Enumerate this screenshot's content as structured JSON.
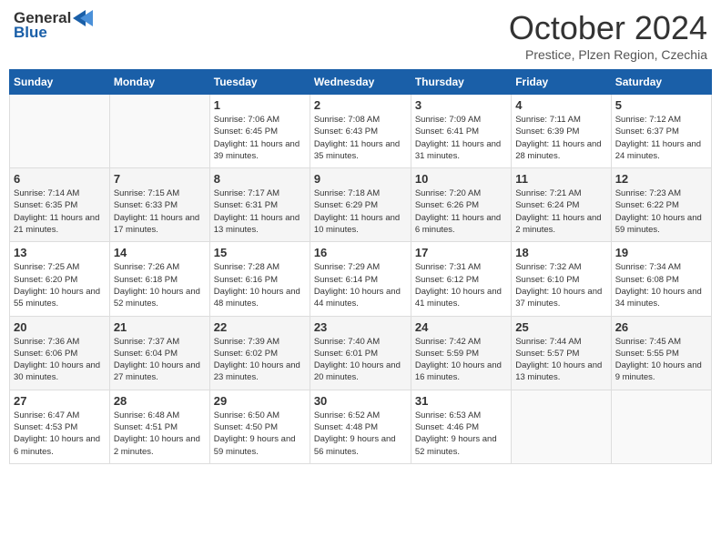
{
  "header": {
    "logo_line1": "General",
    "logo_line2": "Blue",
    "month": "October 2024",
    "location": "Prestice, Plzen Region, Czechia"
  },
  "days_of_week": [
    "Sunday",
    "Monday",
    "Tuesday",
    "Wednesday",
    "Thursday",
    "Friday",
    "Saturday"
  ],
  "weeks": [
    [
      {
        "day": "",
        "content": ""
      },
      {
        "day": "",
        "content": ""
      },
      {
        "day": "1",
        "content": "Sunrise: 7:06 AM\nSunset: 6:45 PM\nDaylight: 11 hours and 39 minutes."
      },
      {
        "day": "2",
        "content": "Sunrise: 7:08 AM\nSunset: 6:43 PM\nDaylight: 11 hours and 35 minutes."
      },
      {
        "day": "3",
        "content": "Sunrise: 7:09 AM\nSunset: 6:41 PM\nDaylight: 11 hours and 31 minutes."
      },
      {
        "day": "4",
        "content": "Sunrise: 7:11 AM\nSunset: 6:39 PM\nDaylight: 11 hours and 28 minutes."
      },
      {
        "day": "5",
        "content": "Sunrise: 7:12 AM\nSunset: 6:37 PM\nDaylight: 11 hours and 24 minutes."
      }
    ],
    [
      {
        "day": "6",
        "content": "Sunrise: 7:14 AM\nSunset: 6:35 PM\nDaylight: 11 hours and 21 minutes."
      },
      {
        "day": "7",
        "content": "Sunrise: 7:15 AM\nSunset: 6:33 PM\nDaylight: 11 hours and 17 minutes."
      },
      {
        "day": "8",
        "content": "Sunrise: 7:17 AM\nSunset: 6:31 PM\nDaylight: 11 hours and 13 minutes."
      },
      {
        "day": "9",
        "content": "Sunrise: 7:18 AM\nSunset: 6:29 PM\nDaylight: 11 hours and 10 minutes."
      },
      {
        "day": "10",
        "content": "Sunrise: 7:20 AM\nSunset: 6:26 PM\nDaylight: 11 hours and 6 minutes."
      },
      {
        "day": "11",
        "content": "Sunrise: 7:21 AM\nSunset: 6:24 PM\nDaylight: 11 hours and 2 minutes."
      },
      {
        "day": "12",
        "content": "Sunrise: 7:23 AM\nSunset: 6:22 PM\nDaylight: 10 hours and 59 minutes."
      }
    ],
    [
      {
        "day": "13",
        "content": "Sunrise: 7:25 AM\nSunset: 6:20 PM\nDaylight: 10 hours and 55 minutes."
      },
      {
        "day": "14",
        "content": "Sunrise: 7:26 AM\nSunset: 6:18 PM\nDaylight: 10 hours and 52 minutes."
      },
      {
        "day": "15",
        "content": "Sunrise: 7:28 AM\nSunset: 6:16 PM\nDaylight: 10 hours and 48 minutes."
      },
      {
        "day": "16",
        "content": "Sunrise: 7:29 AM\nSunset: 6:14 PM\nDaylight: 10 hours and 44 minutes."
      },
      {
        "day": "17",
        "content": "Sunrise: 7:31 AM\nSunset: 6:12 PM\nDaylight: 10 hours and 41 minutes."
      },
      {
        "day": "18",
        "content": "Sunrise: 7:32 AM\nSunset: 6:10 PM\nDaylight: 10 hours and 37 minutes."
      },
      {
        "day": "19",
        "content": "Sunrise: 7:34 AM\nSunset: 6:08 PM\nDaylight: 10 hours and 34 minutes."
      }
    ],
    [
      {
        "day": "20",
        "content": "Sunrise: 7:36 AM\nSunset: 6:06 PM\nDaylight: 10 hours and 30 minutes."
      },
      {
        "day": "21",
        "content": "Sunrise: 7:37 AM\nSunset: 6:04 PM\nDaylight: 10 hours and 27 minutes."
      },
      {
        "day": "22",
        "content": "Sunrise: 7:39 AM\nSunset: 6:02 PM\nDaylight: 10 hours and 23 minutes."
      },
      {
        "day": "23",
        "content": "Sunrise: 7:40 AM\nSunset: 6:01 PM\nDaylight: 10 hours and 20 minutes."
      },
      {
        "day": "24",
        "content": "Sunrise: 7:42 AM\nSunset: 5:59 PM\nDaylight: 10 hours and 16 minutes."
      },
      {
        "day": "25",
        "content": "Sunrise: 7:44 AM\nSunset: 5:57 PM\nDaylight: 10 hours and 13 minutes."
      },
      {
        "day": "26",
        "content": "Sunrise: 7:45 AM\nSunset: 5:55 PM\nDaylight: 10 hours and 9 minutes."
      }
    ],
    [
      {
        "day": "27",
        "content": "Sunrise: 6:47 AM\nSunset: 4:53 PM\nDaylight: 10 hours and 6 minutes."
      },
      {
        "day": "28",
        "content": "Sunrise: 6:48 AM\nSunset: 4:51 PM\nDaylight: 10 hours and 2 minutes."
      },
      {
        "day": "29",
        "content": "Sunrise: 6:50 AM\nSunset: 4:50 PM\nDaylight: 9 hours and 59 minutes."
      },
      {
        "day": "30",
        "content": "Sunrise: 6:52 AM\nSunset: 4:48 PM\nDaylight: 9 hours and 56 minutes."
      },
      {
        "day": "31",
        "content": "Sunrise: 6:53 AM\nSunset: 4:46 PM\nDaylight: 9 hours and 52 minutes."
      },
      {
        "day": "",
        "content": ""
      },
      {
        "day": "",
        "content": ""
      }
    ]
  ]
}
